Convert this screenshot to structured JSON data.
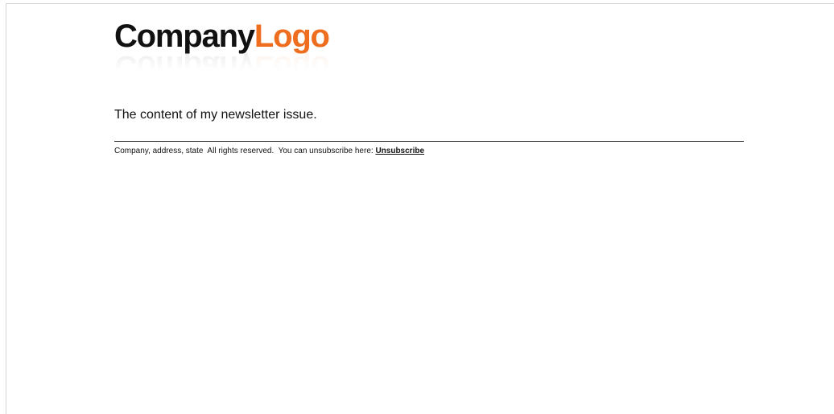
{
  "logo": {
    "word_dark": "Company",
    "word_accent": "Logo",
    "accent_color": "#ee6d1e",
    "dark_color": "#111111"
  },
  "newsletter": {
    "content_text": "The content of my newsletter issue."
  },
  "footer": {
    "text": "Company, address, state  All rights reserved.  You can unsubscribe here: ",
    "unsubscribe_label": "Unsubscribe"
  }
}
